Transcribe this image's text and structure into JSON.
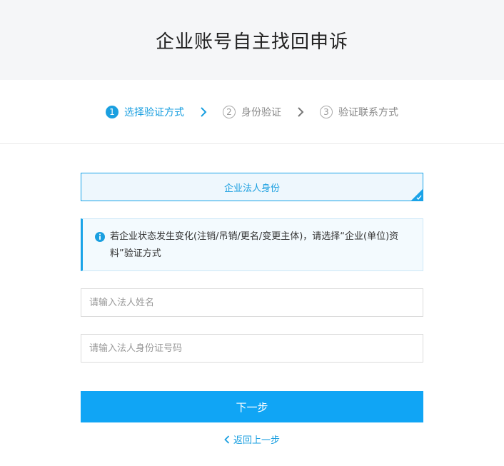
{
  "header": {
    "title": "企业账号自主找回申诉"
  },
  "steps": [
    {
      "num": "1",
      "label": "选择验证方式",
      "active": true
    },
    {
      "num": "2",
      "label": "身份验证",
      "active": false
    },
    {
      "num": "3",
      "label": "验证联系方式",
      "active": false
    }
  ],
  "option": {
    "label": "企业法人身份",
    "selected": true
  },
  "notice": {
    "icon": "info-icon",
    "text": "若企业状态发生变化(注销/吊销/更名/变更主体)，请选择“企业(单位)资料”验证方式"
  },
  "form": {
    "name_placeholder": "请输入法人姓名",
    "name_value": "",
    "id_placeholder": "请输入法人身份证号码",
    "id_value": ""
  },
  "actions": {
    "next_label": "下一步",
    "back_label": "返回上一步"
  },
  "colors": {
    "accent": "#1a9fe0",
    "button": "#10a5f5",
    "header_bg": "#f5f6f8"
  }
}
